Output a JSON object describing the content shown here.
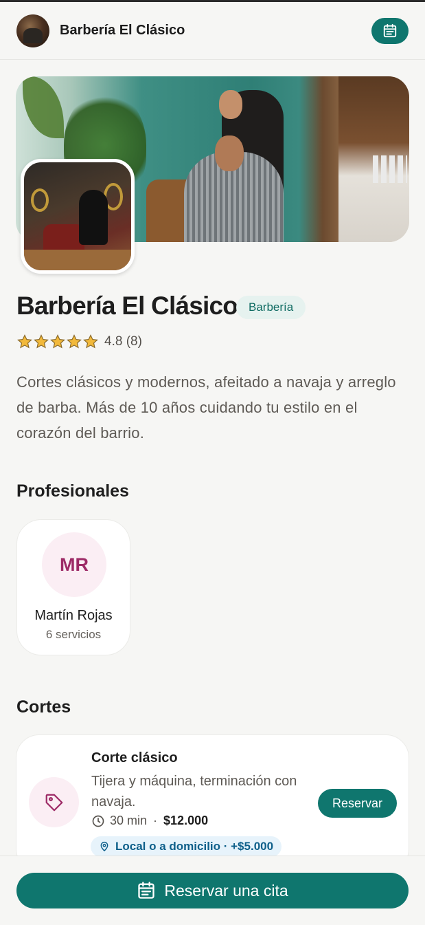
{
  "header": {
    "title": "Barbería El Clásico",
    "avatar_icon": "shop-avatar",
    "calendar_icon": "calendar-icon"
  },
  "business": {
    "name": "Barbería El Clásico",
    "category": "Barbería",
    "rating_value": "4.8",
    "rating_count": "(8)",
    "rating_text": "4.8 (8)",
    "stars": 5,
    "description": "Cortes clásicos y modernos, afeitado a navaja y arreglo de barba. Más de 10 años cuidando tu estilo en el corazón del barrio."
  },
  "professionals": {
    "title": "Profesionales",
    "items": [
      {
        "initials": "MR",
        "name": "Martín Rojas",
        "services": "6 servicios"
      }
    ]
  },
  "services": {
    "title": "Cortes",
    "items": [
      {
        "name": "Corte clásico",
        "description": "Tijera y máquina, terminación con navaja.",
        "duration": "30 min",
        "separator": "·",
        "price": "$12.000",
        "location": "Local o a domicilio · +$5.000",
        "button": "Reservar",
        "icon": "tag-icon"
      }
    ]
  },
  "footer": {
    "book_label": "Reservar una cita"
  },
  "colors": {
    "primary": "#0f766e",
    "accent_pink": "#9d2a66",
    "star": "#f2b93b",
    "location_blue": "#0e5f8a"
  }
}
